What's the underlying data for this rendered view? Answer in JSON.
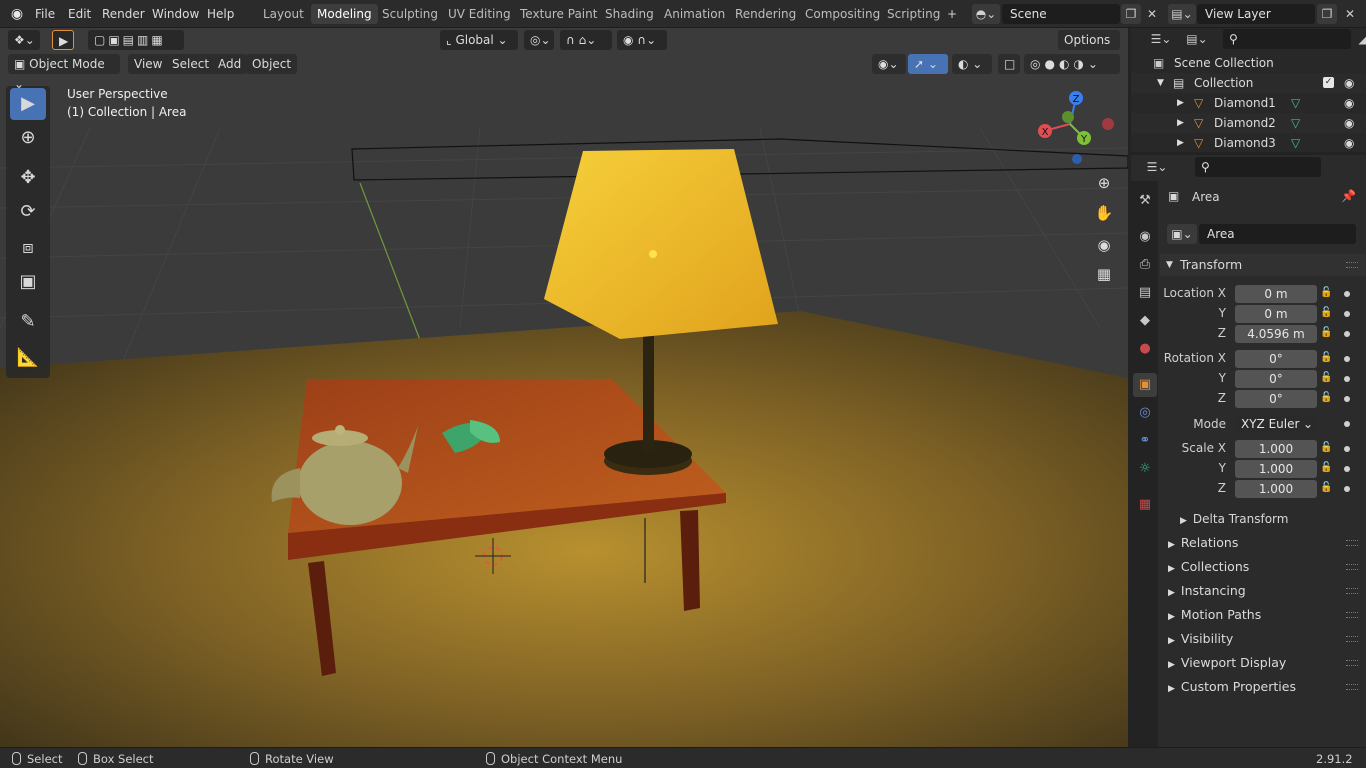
{
  "menubar": {
    "items": [
      "File",
      "Edit",
      "Render",
      "Window",
      "Help"
    ],
    "workspaces": [
      "Layout",
      "Modeling",
      "Sculpting",
      "UV Editing",
      "Texture Paint",
      "Shading",
      "Animation",
      "Rendering",
      "Compositing",
      "Scripting"
    ],
    "active_workspace": "Modeling",
    "scene": "Scene",
    "view_layer": "View Layer"
  },
  "viewport": {
    "orientation": "Global",
    "options_label": "Options",
    "mode": "Object Mode",
    "menus": [
      "View",
      "Select",
      "Add",
      "Object"
    ],
    "perspective": "User Perspective",
    "collection_info": "(1) Collection | Area",
    "gizmo_axes": [
      "X",
      "Y",
      "Z"
    ]
  },
  "outliner": {
    "root": "Scene Collection",
    "collection": "Collection",
    "objects": [
      "Diamond1",
      "Diamond2",
      "Diamond3"
    ]
  },
  "properties": {
    "object_name": "Area",
    "name_field": "Area",
    "section_transform": "Transform",
    "location": {
      "label": "Location X",
      "x": "0 m",
      "y": "0 m",
      "z": "4.0596 m"
    },
    "rotation": {
      "label": "Rotation X",
      "x": "0°",
      "y": "0°",
      "z": "0°"
    },
    "mode_label": "Mode",
    "mode_value": "XYZ Euler",
    "scale": {
      "label": "Scale X",
      "x": "1.000",
      "y": "1.000",
      "z": "1.000"
    },
    "axis_y": "Y",
    "axis_z": "Z",
    "delta_transform": "Delta Transform",
    "sections": [
      "Relations",
      "Collections",
      "Instancing",
      "Motion Paths",
      "Visibility",
      "Viewport Display",
      "Custom Properties"
    ]
  },
  "statusbar": {
    "select": "Select",
    "box_select": "Box Select",
    "rotate_view": "Rotate View",
    "context_menu": "Object Context Menu",
    "version": "2.91.2"
  },
  "colors": {
    "accent": "#4772b3",
    "lamp_shade": "#f2bf2b",
    "table_top": "#b3501f",
    "object_orange": "#e0913a",
    "mesh_green": "#3fbf8f"
  }
}
